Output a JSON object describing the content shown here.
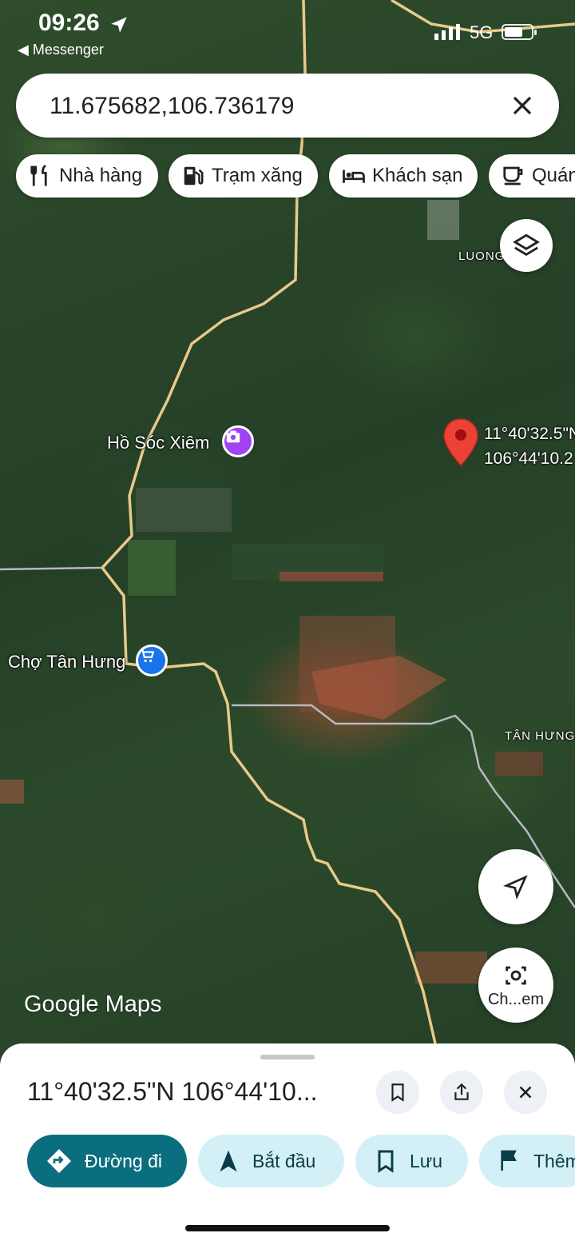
{
  "status_bar": {
    "time": "09:26",
    "back_app": "◀ Messenger",
    "network": "5G",
    "battery_level": 0.7
  },
  "search": {
    "value": "11.675682,106.736179"
  },
  "chips": [
    {
      "label": "Nhà hàng",
      "icon": "restaurant-icon"
    },
    {
      "label": "Trạm xăng",
      "icon": "gas-station-icon"
    },
    {
      "label": "Khách sạn",
      "icon": "hotel-icon"
    },
    {
      "label": "Quán",
      "icon": "coffee-icon"
    }
  ],
  "map": {
    "labels": {
      "luong": "LUONG",
      "ho_soc_xiem": "Hồ Sóc Xiêm",
      "cho_tan_hung": "Chợ Tân Hưng",
      "tan_hung": "TÂN HƯNG",
      "pin_lat": "11°40'32.5\"N",
      "pin_lng": "106°44'10.2"
    },
    "logo": "Google Maps",
    "lens_label": "Ch...em",
    "pin_color": "#ea4335",
    "poi_photo_color": "#a142f4",
    "poi_shop_color": "#1a73e8"
  },
  "sheet": {
    "title": "11°40'32.5\"N 106°44'10...",
    "actions": [
      {
        "label": "Đường đi",
        "icon": "directions-icon"
      },
      {
        "label": "Bắt đầu",
        "icon": "navigation-arrow-icon"
      },
      {
        "label": "Lưu",
        "icon": "bookmark-icon"
      },
      {
        "label": "Thêm",
        "icon": "flag-icon"
      }
    ],
    "colors": {
      "primary": "#0b6e7f",
      "secondary": "#d3f0f7"
    }
  }
}
